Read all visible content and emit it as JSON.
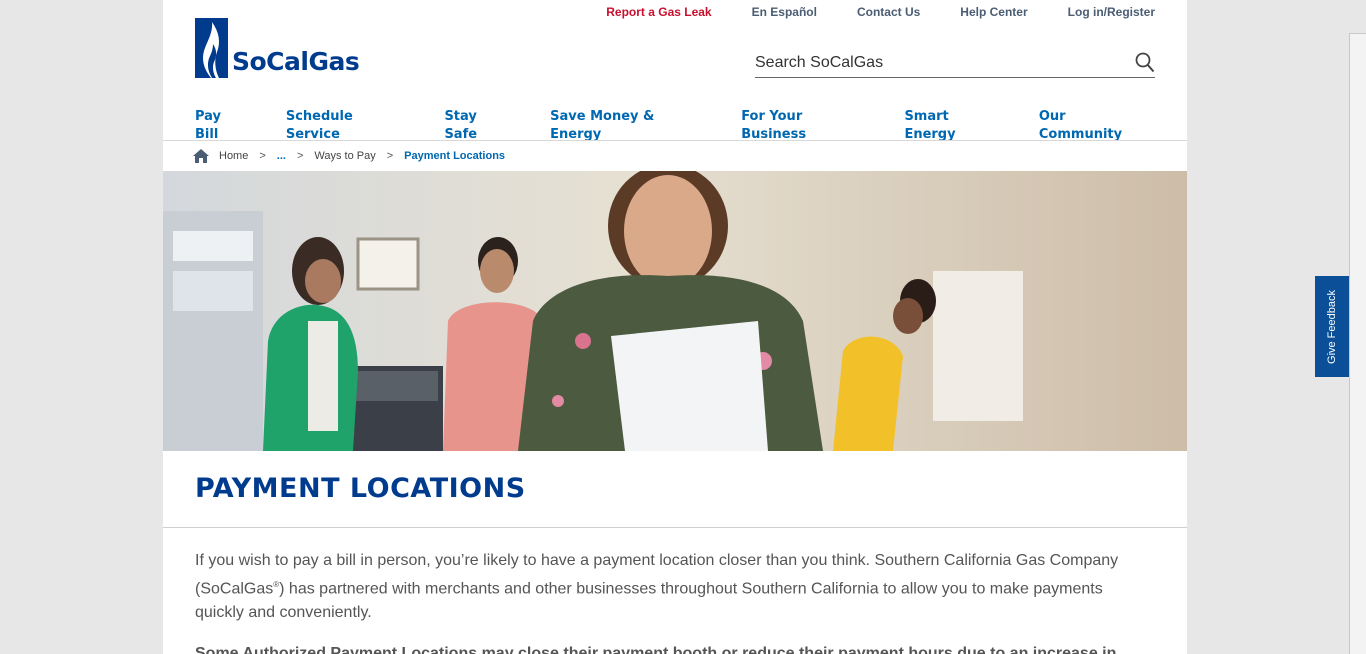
{
  "utility_nav": [
    {
      "label": "Report a Gas Leak",
      "color": "#c8102e"
    },
    {
      "label": "En Español"
    },
    {
      "label": "Contact Us"
    },
    {
      "label": "Help Center"
    },
    {
      "label": "Log in/Register"
    }
  ],
  "logo": {
    "text": "SoCalGas",
    "icon": "flame-logo-icon",
    "color": "#003b8e"
  },
  "search": {
    "placeholder": "Search SoCalGas",
    "icon": "search-icon"
  },
  "main_nav": [
    {
      "label": "Pay Bill"
    },
    {
      "label": "Schedule Service"
    },
    {
      "label": "Stay Safe"
    },
    {
      "label": "Save Money & Energy"
    },
    {
      "label": "For Your Business"
    },
    {
      "label": "Smart Energy"
    },
    {
      "label": "Our Community"
    }
  ],
  "breadcrumb": {
    "home": "Home",
    "separator": ">",
    "ellipsis": "...",
    "parent": "Ways to Pay",
    "current": "Payment Locations"
  },
  "page": {
    "title": "PAYMENT LOCATIONS",
    "intro_part1": "If you wish to pay a bill in person, you’re likely to have a payment location closer than you think. Southern California Gas Company (SoCalGas",
    "intro_reg": "®",
    "intro_part2": ") has partnered with merchants and other businesses throughout Southern California to allow you to make payments quickly and conveniently.",
    "notice": "Some Authorized Payment Locations may close their payment booth or reduce their payment hours due to an increase in"
  },
  "feedback": {
    "label": "Give Feedback"
  },
  "colors": {
    "brand_blue": "#003b8e",
    "link_blue": "#0067b1",
    "alert_red": "#c8102e",
    "feedback_bg": "#0a4f97"
  }
}
